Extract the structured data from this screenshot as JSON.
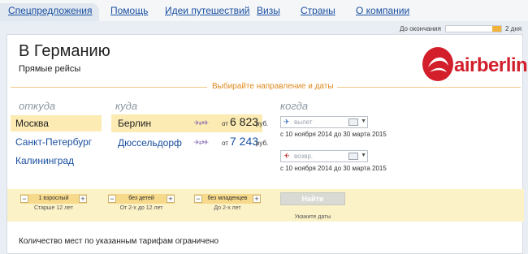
{
  "tabs": [
    {
      "label": "Спецпредложения",
      "active": true
    },
    {
      "label": "Помощь"
    },
    {
      "label": "Идеи путешествий"
    },
    {
      "label": "Визы"
    },
    {
      "label": "Страны"
    },
    {
      "label": "О компании"
    }
  ],
  "countdown": {
    "label": "До окончания",
    "value": "2 дня",
    "remaining_fraction": 0.16
  },
  "page": {
    "title": "В Германию",
    "subtitle": "Прямые рейсы",
    "choose_label": "Выбирайте направление и даты"
  },
  "logo": {
    "text": "airberlin",
    "color": "#d21f2b"
  },
  "columns": {
    "from": "откуда",
    "to": "куда",
    "when": "когда"
  },
  "origins": [
    {
      "name": "Москва",
      "selected": true
    },
    {
      "name": "Санкт-Петербург"
    },
    {
      "name": "Калининград"
    }
  ],
  "destinations": [
    {
      "name": "Берлин",
      "ot": "от",
      "price": "6 823",
      "currency": "руб.",
      "selected": true
    },
    {
      "name": "Дюссельдорф",
      "ot": "от",
      "price": "7 243",
      "currency": "руб."
    }
  ],
  "dates": {
    "departure": {
      "placeholder": "вылет",
      "range": "с 10 ноября 2014 до 30 марта 2015"
    },
    "return": {
      "placeholder": "возвр.",
      "range": "с 10 ноября 2014 до 30 марта 2015"
    }
  },
  "passengers": [
    {
      "value": "1 взрослый",
      "sub": "Старше 12 лет"
    },
    {
      "value": "без детей",
      "sub": "От 2-х до 12 лет"
    },
    {
      "value": "без младенцев",
      "sub": "До 2-х лет"
    }
  ],
  "search": {
    "button": "Найти",
    "hint": "Укажите даты"
  },
  "note": "Количество мест по указанным тарифам ограничено",
  "colors": {
    "accent": "#f1b33c",
    "link": "#1a4fa0",
    "highlight": "#fcebb2",
    "bar": "#fcf2c7"
  }
}
